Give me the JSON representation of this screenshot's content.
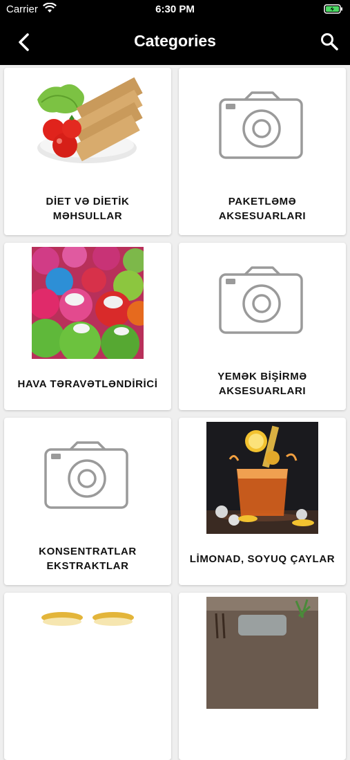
{
  "status_bar": {
    "carrier": "Carrier",
    "time": "6:30 PM"
  },
  "header": {
    "title": "Categories"
  },
  "colors": {
    "bar_bg": "#000000",
    "page_bg": "#efefef",
    "placeholder_icon": "#9a9a9a"
  },
  "categories": [
    {
      "label": "DİET VƏ DİETİK\nMƏHSULLAR",
      "image": "crackers-tomatoes-photo"
    },
    {
      "label": "PAKETLƏMƏ\nAKSESUARLARI",
      "image": "camera-placeholder-icon"
    },
    {
      "label": "HAVA TƏRAVƏTLƏNDİRİCİ",
      "image": "colorful-air-fresheners-photo"
    },
    {
      "label": "YEMƏK BİŞİRMƏ\nAKSESUARLARI",
      "image": "camera-placeholder-icon"
    },
    {
      "label": "KONSENTRATLAR\nEKSTRAKTLAR",
      "image": "camera-placeholder-icon"
    },
    {
      "label": "LİMONAD, SOYUQ ÇAYLAR",
      "image": "iced-tea-lemon-photo"
    }
  ]
}
